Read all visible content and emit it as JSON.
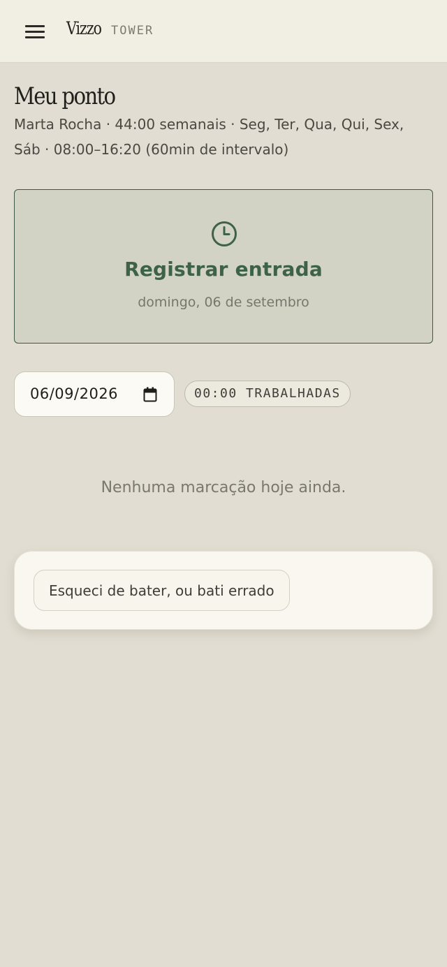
{
  "header": {
    "brand_name": "Vizzo",
    "brand_sub": "TOWER",
    "menu_icon": "hamburger-menu-icon"
  },
  "page": {
    "title": "Meu ponto",
    "subtitle": "Marta Rocha · 44:00 semanais · Seg, Ter, Qua, Qui, Sex, Sáb · 08:00–16:20 (60min de intervalo)"
  },
  "punch": {
    "icon": "clock-icon",
    "title": "Registrar entrada",
    "date": "domingo, 06 de setembro"
  },
  "filters": {
    "date_value": "06/09/2026",
    "calendar_icon": "calendar-icon",
    "hours_worked": "00:00 TRABALHADAS"
  },
  "empty_state": {
    "message": "Nenhuma marcação hoje ainda."
  },
  "correction": {
    "button_label": "Esqueci de bater, ou bati errado"
  },
  "colors": {
    "background": "#e1ddd2",
    "header_bg": "#f1efe4",
    "accent_green": "#3e6247",
    "card_bg": "#d2d2c5"
  }
}
